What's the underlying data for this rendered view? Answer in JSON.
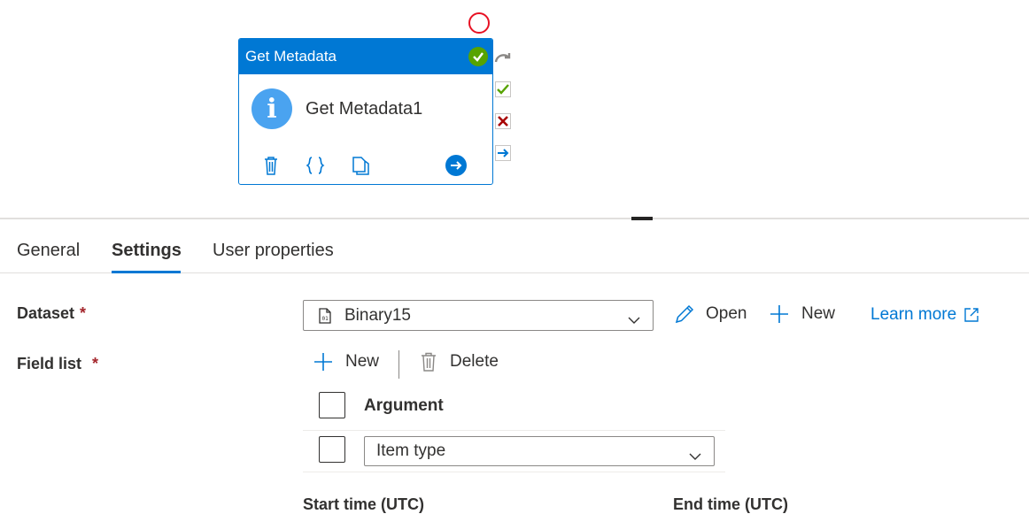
{
  "activity": {
    "type_label": "Get Metadata",
    "name": "Get Metadata1",
    "info_glyph": "i"
  },
  "icons": {
    "status": "success-check-icon",
    "delete": "trash-icon",
    "code": "braces-icon",
    "copy": "copy-icon",
    "navigate": "arrow-right-circle-icon"
  },
  "colors": {
    "accent": "#0078d4",
    "success": "#57a300",
    "failure": "#a80000",
    "required": "#a4262c",
    "breakpoint": "#e81123"
  },
  "tabs": [
    {
      "label": "General"
    },
    {
      "label": "Settings",
      "active": true
    },
    {
      "label": "User properties"
    }
  ],
  "dataset": {
    "label": "Dataset",
    "required_mark": "*",
    "value": "Binary15",
    "open_label": "Open",
    "new_label": "New",
    "learn_more_label": "Learn more"
  },
  "field_list": {
    "label": "Field list",
    "required_mark": "*",
    "new_label": "New",
    "delete_label": "Delete",
    "header": "Argument",
    "rows": [
      {
        "value": "Item type"
      }
    ]
  },
  "time": {
    "start_label": "Start time (UTC)",
    "end_label": "End time (UTC)"
  }
}
